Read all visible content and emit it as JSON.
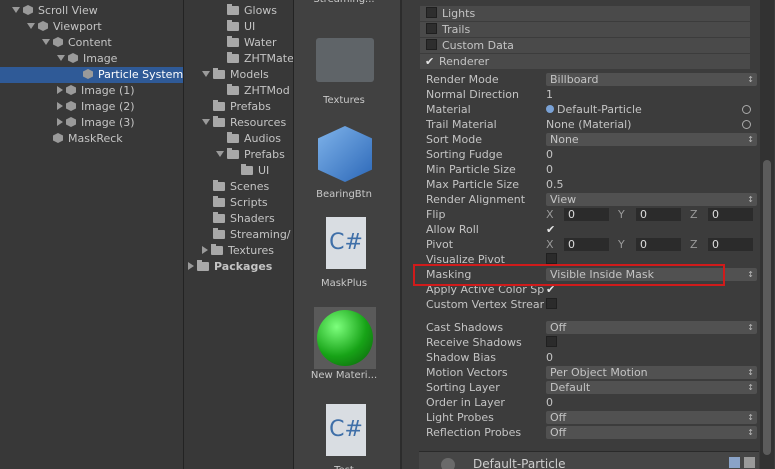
{
  "hierarchy": {
    "items": [
      {
        "label": "Scroll View",
        "indent": 0,
        "expand": "down",
        "icon": "cube",
        "sel": false
      },
      {
        "label": "Viewport",
        "indent": 1,
        "expand": "down",
        "icon": "cube",
        "sel": false
      },
      {
        "label": "Content",
        "indent": 2,
        "expand": "down",
        "icon": "cube",
        "sel": false
      },
      {
        "label": "Image",
        "indent": 3,
        "expand": "down",
        "icon": "cube",
        "sel": false
      },
      {
        "label": "Particle System",
        "indent": 4,
        "expand": "none",
        "icon": "cube",
        "sel": true
      },
      {
        "label": "Image (1)",
        "indent": 3,
        "expand": "right",
        "icon": "cube",
        "sel": false
      },
      {
        "label": "Image (2)",
        "indent": 3,
        "expand": "right",
        "icon": "cube",
        "sel": false
      },
      {
        "label": "Image (3)",
        "indent": 3,
        "expand": "right",
        "icon": "cube",
        "sel": false
      },
      {
        "label": "MaskReck",
        "indent": 2,
        "expand": "none",
        "icon": "cube",
        "sel": false
      }
    ]
  },
  "project_tree": {
    "items": [
      {
        "label": "Glows",
        "indent": 2,
        "expand": "none"
      },
      {
        "label": "UI",
        "indent": 2,
        "expand": "none"
      },
      {
        "label": "Water",
        "indent": 2,
        "expand": "none"
      },
      {
        "label": "ZHTMate",
        "indent": 2,
        "expand": "none"
      },
      {
        "label": "Models",
        "indent": 1,
        "expand": "down"
      },
      {
        "label": "ZHTMod",
        "indent": 2,
        "expand": "none"
      },
      {
        "label": "Prefabs",
        "indent": 1,
        "expand": "none"
      },
      {
        "label": "Resources",
        "indent": 1,
        "expand": "down"
      },
      {
        "label": "Audios",
        "indent": 2,
        "expand": "none"
      },
      {
        "label": "Prefabs",
        "indent": 2,
        "expand": "down"
      },
      {
        "label": "UI",
        "indent": 3,
        "expand": "none"
      },
      {
        "label": "Scenes",
        "indent": 1,
        "expand": "none"
      },
      {
        "label": "Scripts",
        "indent": 1,
        "expand": "none"
      },
      {
        "label": "Shaders",
        "indent": 1,
        "expand": "none"
      },
      {
        "label": "Streaming/",
        "indent": 1,
        "expand": "none"
      },
      {
        "label": "Textures",
        "indent": 1,
        "expand": "right"
      },
      {
        "label": "Packages",
        "indent": 0,
        "expand": "right",
        "bold": true
      }
    ]
  },
  "assets": [
    {
      "name": "Streaming...",
      "kind": "none"
    },
    {
      "name": "Textures",
      "kind": "folder"
    },
    {
      "name": "BearingBtn",
      "kind": "cube"
    },
    {
      "name": "MaskPlus",
      "kind": "csharp"
    },
    {
      "name": "New Materi...",
      "kind": "sphere"
    },
    {
      "name": "Test",
      "kind": "csharp"
    }
  ],
  "inspector": {
    "sections": [
      {
        "label": "Lights",
        "checked": false
      },
      {
        "label": "Trails",
        "checked": false
      },
      {
        "label": "Custom Data",
        "checked": false
      },
      {
        "label": "Renderer",
        "checked": true
      }
    ],
    "props": [
      {
        "label": "Render Mode",
        "type": "dropdown",
        "value": "Billboard"
      },
      {
        "label": "Normal Direction",
        "type": "text",
        "value": "1"
      },
      {
        "label": "Material",
        "type": "object",
        "value": "Default-Particle"
      },
      {
        "label": "Trail Material",
        "type": "object",
        "value": "None (Material)"
      },
      {
        "label": "Sort Mode",
        "type": "dropdown",
        "value": "None"
      },
      {
        "label": "Sorting Fudge",
        "type": "text",
        "value": "0"
      },
      {
        "label": "Min Particle Size",
        "type": "text",
        "value": "0"
      },
      {
        "label": "Max Particle Size",
        "type": "text",
        "value": "0.5"
      },
      {
        "label": "Render Alignment",
        "type": "dropdown",
        "value": "View"
      },
      {
        "label": "Flip",
        "type": "xyz",
        "x": "0",
        "y": "0",
        "z": "0"
      },
      {
        "label": "Allow Roll",
        "type": "check",
        "checked": true
      },
      {
        "label": "Pivot",
        "type": "xyz",
        "x": "0",
        "y": "0",
        "z": "0"
      },
      {
        "label": "Visualize Pivot",
        "type": "check",
        "checked": false
      },
      {
        "label": "Masking",
        "type": "dropdown",
        "value": "Visible Inside Mask"
      },
      {
        "label": "Apply Active Color Space",
        "type": "check",
        "checked": true
      },
      {
        "label": "Custom Vertex Streams",
        "type": "check",
        "checked": false
      },
      {
        "label": "Cast Shadows",
        "type": "dropdown",
        "value": "Off"
      },
      {
        "label": "Receive Shadows",
        "type": "check",
        "checked": false
      },
      {
        "label": "Shadow Bias",
        "type": "text",
        "value": "0"
      },
      {
        "label": "Motion Vectors",
        "type": "dropdown",
        "value": "Per Object Motion"
      },
      {
        "label": "Sorting Layer",
        "type": "dropdown",
        "value": "Default"
      },
      {
        "label": "Order in Layer",
        "type": "text",
        "value": "0"
      },
      {
        "label": "Light Probes",
        "type": "dropdown",
        "value": "Off"
      },
      {
        "label": "Reflection Probes",
        "type": "dropdown",
        "value": "Off"
      }
    ],
    "axis_labels": {
      "x": "X",
      "y": "Y",
      "z": "Z"
    },
    "footer_title": "Default-Particle"
  }
}
